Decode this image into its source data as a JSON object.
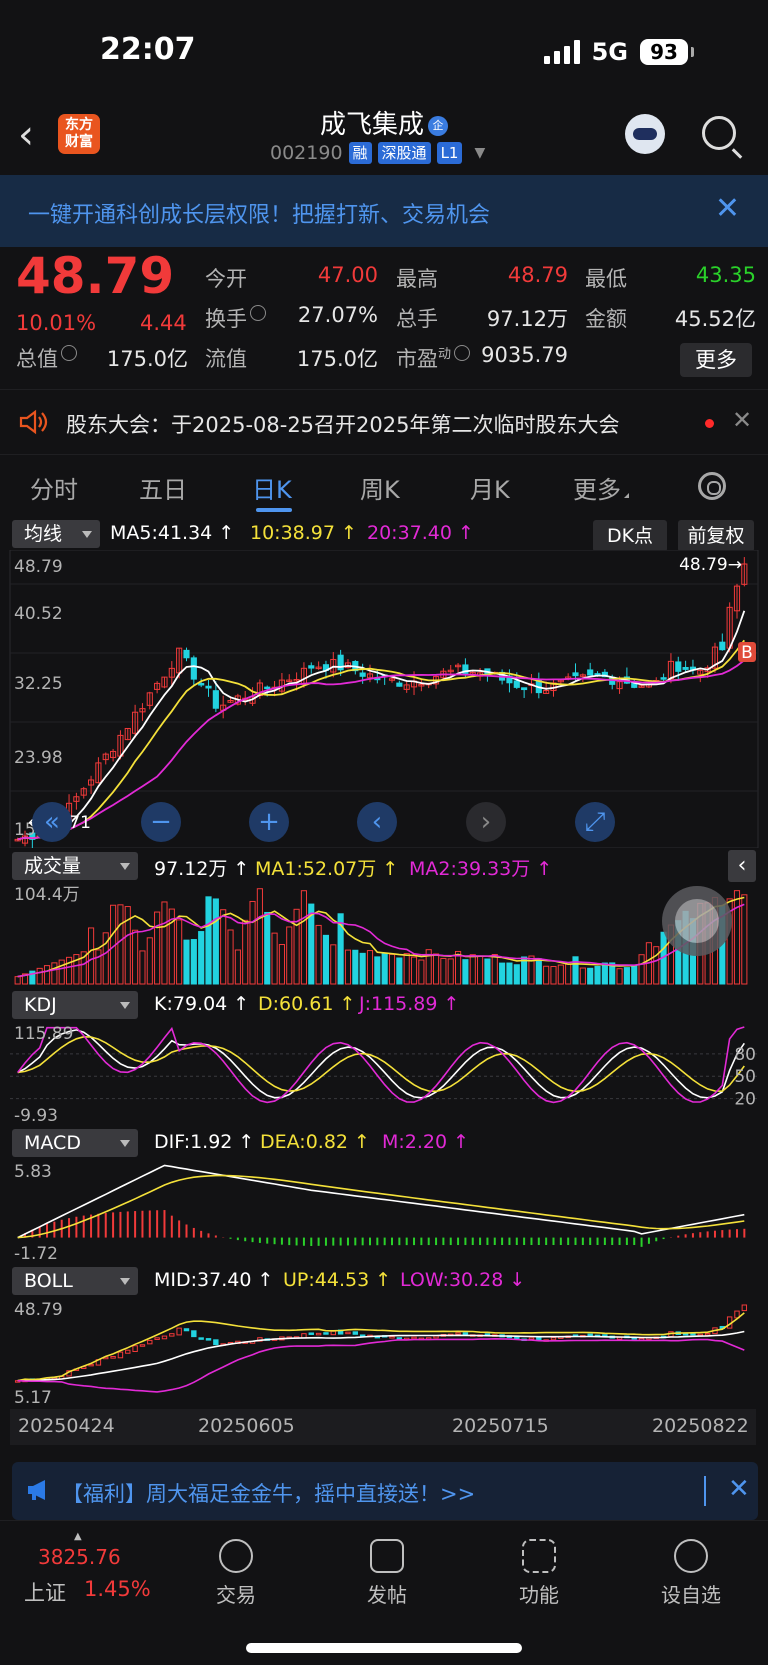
{
  "status_bar": {
    "time": "22:07",
    "network": "5G",
    "battery": "93"
  },
  "header": {
    "back_icon": "chevron-left-icon",
    "logo_text_1": "东方",
    "logo_text_2": "财富",
    "stock_name": "成飞集成",
    "stock_badge": "企",
    "stock_code": "002190",
    "tags": [
      "融",
      "深股通",
      "L1"
    ]
  },
  "banner": {
    "text": "一键开通科创成长层权限！把握打新、交易机会",
    "close": "✕"
  },
  "quote": {
    "price": "48.79",
    "change_pct": "10.01%",
    "change": "4.44",
    "fields": [
      {
        "label": "今开",
        "value": "47.00",
        "color": "#f13a3a"
      },
      {
        "label": "最高",
        "value": "48.79",
        "color": "#f13a3a"
      },
      {
        "label": "最低",
        "value": "43.35",
        "color": "#2ad12a"
      },
      {
        "label": "换手",
        "value": "27.07%",
        "color": "#e6e6e6"
      },
      {
        "label": "总手",
        "value": "97.12万",
        "color": "#e6e6e6"
      },
      {
        "label": "金额",
        "value": "45.52亿",
        "color": "#e6e6e6"
      },
      {
        "label": "总值",
        "value": "175.0亿",
        "color": "#e6e6e6"
      },
      {
        "label": "流值",
        "value": "175.0亿",
        "color": "#e6e6e6"
      },
      {
        "label": "市盈",
        "sup": "动",
        "value": "9035.79",
        "color": "#e6e6e6"
      }
    ],
    "more": "更多"
  },
  "notice": {
    "text": "股东大会：于2025-08-25召开2025年第二次临时股东大会",
    "close": "✕"
  },
  "tabs": {
    "items": [
      "分时",
      "五日",
      "日K",
      "周K",
      "月K",
      "更多"
    ],
    "active": 2
  },
  "kline": {
    "selector": "均线",
    "ma5": "MA5:41.34 ↑",
    "ma10": "10:38.97 ↑",
    "ma20": "20:37.40 ↑",
    "dk_button": "DK点",
    "fq_button": "前复权",
    "y_labels": [
      "48.79",
      "40.52",
      "32.25",
      "23.98",
      "15.71"
    ],
    "high_label": "48.79→",
    "low_label": "←15.71",
    "b_marker": "B"
  },
  "volume": {
    "selector": "成交量",
    "value": "97.12万 ↑",
    "ma1": "MA1:52.07万 ↑",
    "ma2": "MA2:39.33万 ↑",
    "y_top": "104.4万"
  },
  "kdj": {
    "selector": "KDJ",
    "k": "K:79.04 ↑",
    "d": "D:60.61 ↑",
    "j": "J:115.89 ↑",
    "y_top": "115.89",
    "y_bottom": "-9.93",
    "levels": [
      "80",
      "50",
      "20"
    ]
  },
  "macd": {
    "selector": "MACD",
    "dif": "DIF:1.92 ↑",
    "dea": "DEA:0.82 ↑",
    "m": "M:2.20 ↑",
    "y_top": "5.83",
    "y_bottom": "-1.72"
  },
  "boll": {
    "selector": "BOLL",
    "mid": "MID:37.40 ↑",
    "up": "UP:44.53 ↑",
    "low": "LOW:30.28 ↓",
    "y_top": "48.79",
    "y_bottom": "5.17"
  },
  "dates": [
    "20250424",
    "20250605",
    "20250715",
    "20250822"
  ],
  "ad": {
    "text": "【福利】周大福足金金牛，摇中直接送！>>",
    "close": "✕"
  },
  "bottom_nav": {
    "index_value": "3825.76",
    "index_name": "上证",
    "index_pct": "1.45%",
    "items": [
      "交易",
      "发帖",
      "功能",
      "设自选"
    ]
  },
  "colors": {
    "up": "#f13a3a",
    "down": "#22d3e0",
    "ma5": "#ffffff",
    "ma10": "#f4e13a",
    "ma20": "#e22ad6",
    "accent": "#4f95ee"
  }
}
